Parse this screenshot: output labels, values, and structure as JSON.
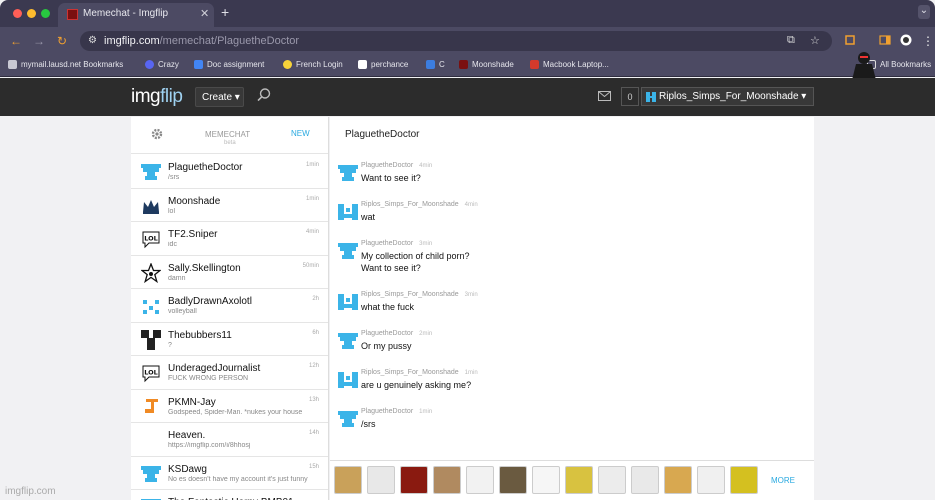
{
  "browser": {
    "tab_title": "Memechat - Imgflip",
    "tab_close": "✕",
    "new_tab": "+",
    "tab_menu": "⌄",
    "url_host": "imgflip.com",
    "url_path": "/memechat/PlaguetheDoctor",
    "bookmarks": [
      {
        "label": "mymail.lausd.net Bookmarks",
        "color": "#c9c9d4"
      },
      {
        "label": "Crazy",
        "color": "#5865f2"
      },
      {
        "label": "Doc assignment",
        "color": "#4285f4"
      },
      {
        "label": "French Login",
        "color": "#f7d33a"
      },
      {
        "label": "perchance",
        "color": "#ffffff"
      },
      {
        "label": "C",
        "color": "#3c7de0"
      },
      {
        "label": "Moonshade",
        "color": "#7a1010"
      },
      {
        "label": "Macbook Laptop...",
        "color": "#d33a2c"
      }
    ],
    "all_bookmarks": "All Bookmarks"
  },
  "site": {
    "logo_img": "img",
    "logo_flip": "flip",
    "create_label": "Create ▾",
    "notif_count": "0",
    "username": "Riplos_Simps_For_Moonshade ▾"
  },
  "sidebar": {
    "title": "MEMECHAT",
    "beta": "beta",
    "new_label": "NEW",
    "conversations": [
      {
        "name": "PlaguetheDoctor",
        "preview": "/srs",
        "time": "1min",
        "avatar": "pixel-cyan-icon"
      },
      {
        "name": "Moonshade",
        "preview": "lol",
        "time": "1min",
        "avatar": "crown-icon"
      },
      {
        "name": "TF2.Sniper",
        "preview": "idc",
        "time": "4min",
        "avatar": "lol-icon"
      },
      {
        "name": "Sally.Skellington",
        "preview": "damn",
        "time": "50min",
        "avatar": "star-icon"
      },
      {
        "name": "BadlyDrawnAxolotl",
        "preview": "volleyball",
        "time": "2h",
        "avatar": "dots-icon"
      },
      {
        "name": "Thebubbers11",
        "preview": "?",
        "time": "6h",
        "avatar": "pixel-dark-icon"
      },
      {
        "name": "UnderagedJournalist",
        "preview": "FUCK WRONG PERSON",
        "time": "12h",
        "avatar": "lol-icon"
      },
      {
        "name": "PKMN-Jay",
        "preview": "Godspeed, Spider-Man. *nukes your house",
        "time": "13h",
        "avatar": "j-icon"
      },
      {
        "name": "Heaven.",
        "preview": "https://imgflip.com/i/8hhosj",
        "time": "14h",
        "avatar": "blank-icon"
      },
      {
        "name": "KSDawg",
        "preview": "No es doesn't have my account it's just funny",
        "time": "15h",
        "avatar": "pixel-cyan-icon"
      },
      {
        "name": "The Fantastic Harpy BMB01",
        "preview": "",
        "time": "",
        "avatar": "pixel-cyan-icon"
      }
    ]
  },
  "chat": {
    "title": "PlaguetheDoctor",
    "messages": [
      {
        "author": "PlaguetheDoctor",
        "ago": "4min",
        "lines": [
          "Want to see it?"
        ],
        "avatar": "doctor"
      },
      {
        "author": "Riplos_Simps_For_Moonshade",
        "ago": "4min",
        "lines": [
          "wat"
        ],
        "avatar": "riplos"
      },
      {
        "author": "PlaguetheDoctor",
        "ago": "3min",
        "lines": [
          "My collection of child porn?",
          "Want to see it?"
        ],
        "avatar": "doctor"
      },
      {
        "author": "Riplos_Simps_For_Moonshade",
        "ago": "3min",
        "lines": [
          "what the fuck"
        ],
        "avatar": "riplos"
      },
      {
        "author": "PlaguetheDoctor",
        "ago": "2min",
        "lines": [
          "Or my pussy"
        ],
        "avatar": "doctor"
      },
      {
        "author": "Riplos_Simps_For_Moonshade",
        "ago": "1min",
        "lines": [
          "are u genuinely asking me?"
        ],
        "avatar": "riplos"
      },
      {
        "author": "PlaguetheDoctor",
        "ago": "1min",
        "lines": [
          "/srs"
        ],
        "avatar": "doctor"
      }
    ],
    "memes": [
      "cat-meme",
      "rage-face-meme",
      "explosion-meme",
      "jesus-meme",
      "forever-alone-meme",
      "doge-jet-meme",
      "blank-face-meme",
      "pencil-meme",
      "troll-face-meme",
      "trollface-meme",
      "doge-meme",
      "lol-face-meme",
      "spongebob-meme"
    ],
    "more_label": "MORE"
  },
  "watermark": "imgflip.com"
}
